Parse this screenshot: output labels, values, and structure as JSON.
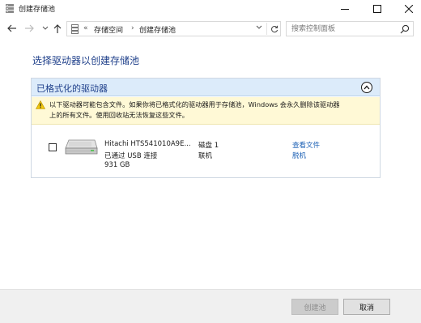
{
  "window": {
    "title": "创建存储池"
  },
  "address": {
    "overflow": "«",
    "crumb1": "存储空间",
    "separator": "›",
    "crumb2": "创建存储池"
  },
  "search": {
    "placeholder": "搜索控制面板"
  },
  "main": {
    "heading": "选择驱动器以创建存储池"
  },
  "group": {
    "title": "已格式化的驱动器",
    "warning_line1": "以下驱动器可能包含文件。如果你将已格式化的驱动器用于存储池，Windows 会永久删除该驱动器",
    "warning_line2": "上的所有文件。使用回收站无法恢复这些文件。",
    "drives": [
      {
        "name": "Hitachi HTS541010A9E...",
        "connection": "已通过 USB 连接",
        "size": "931 GB",
        "disk": "磁盘 1",
        "status": "联机",
        "link_view": "查看文件",
        "link_offline": "脱机",
        "checked": false
      }
    ]
  },
  "footer": {
    "create_label": "创建池",
    "cancel_label": "取消"
  },
  "colors": {
    "heading": "#1e3f8a",
    "group_header_bg": "#dcebfa",
    "warning_bg": "#fff9d6",
    "link": "#1a5fb4",
    "warning_icon": "#f2c80f"
  }
}
